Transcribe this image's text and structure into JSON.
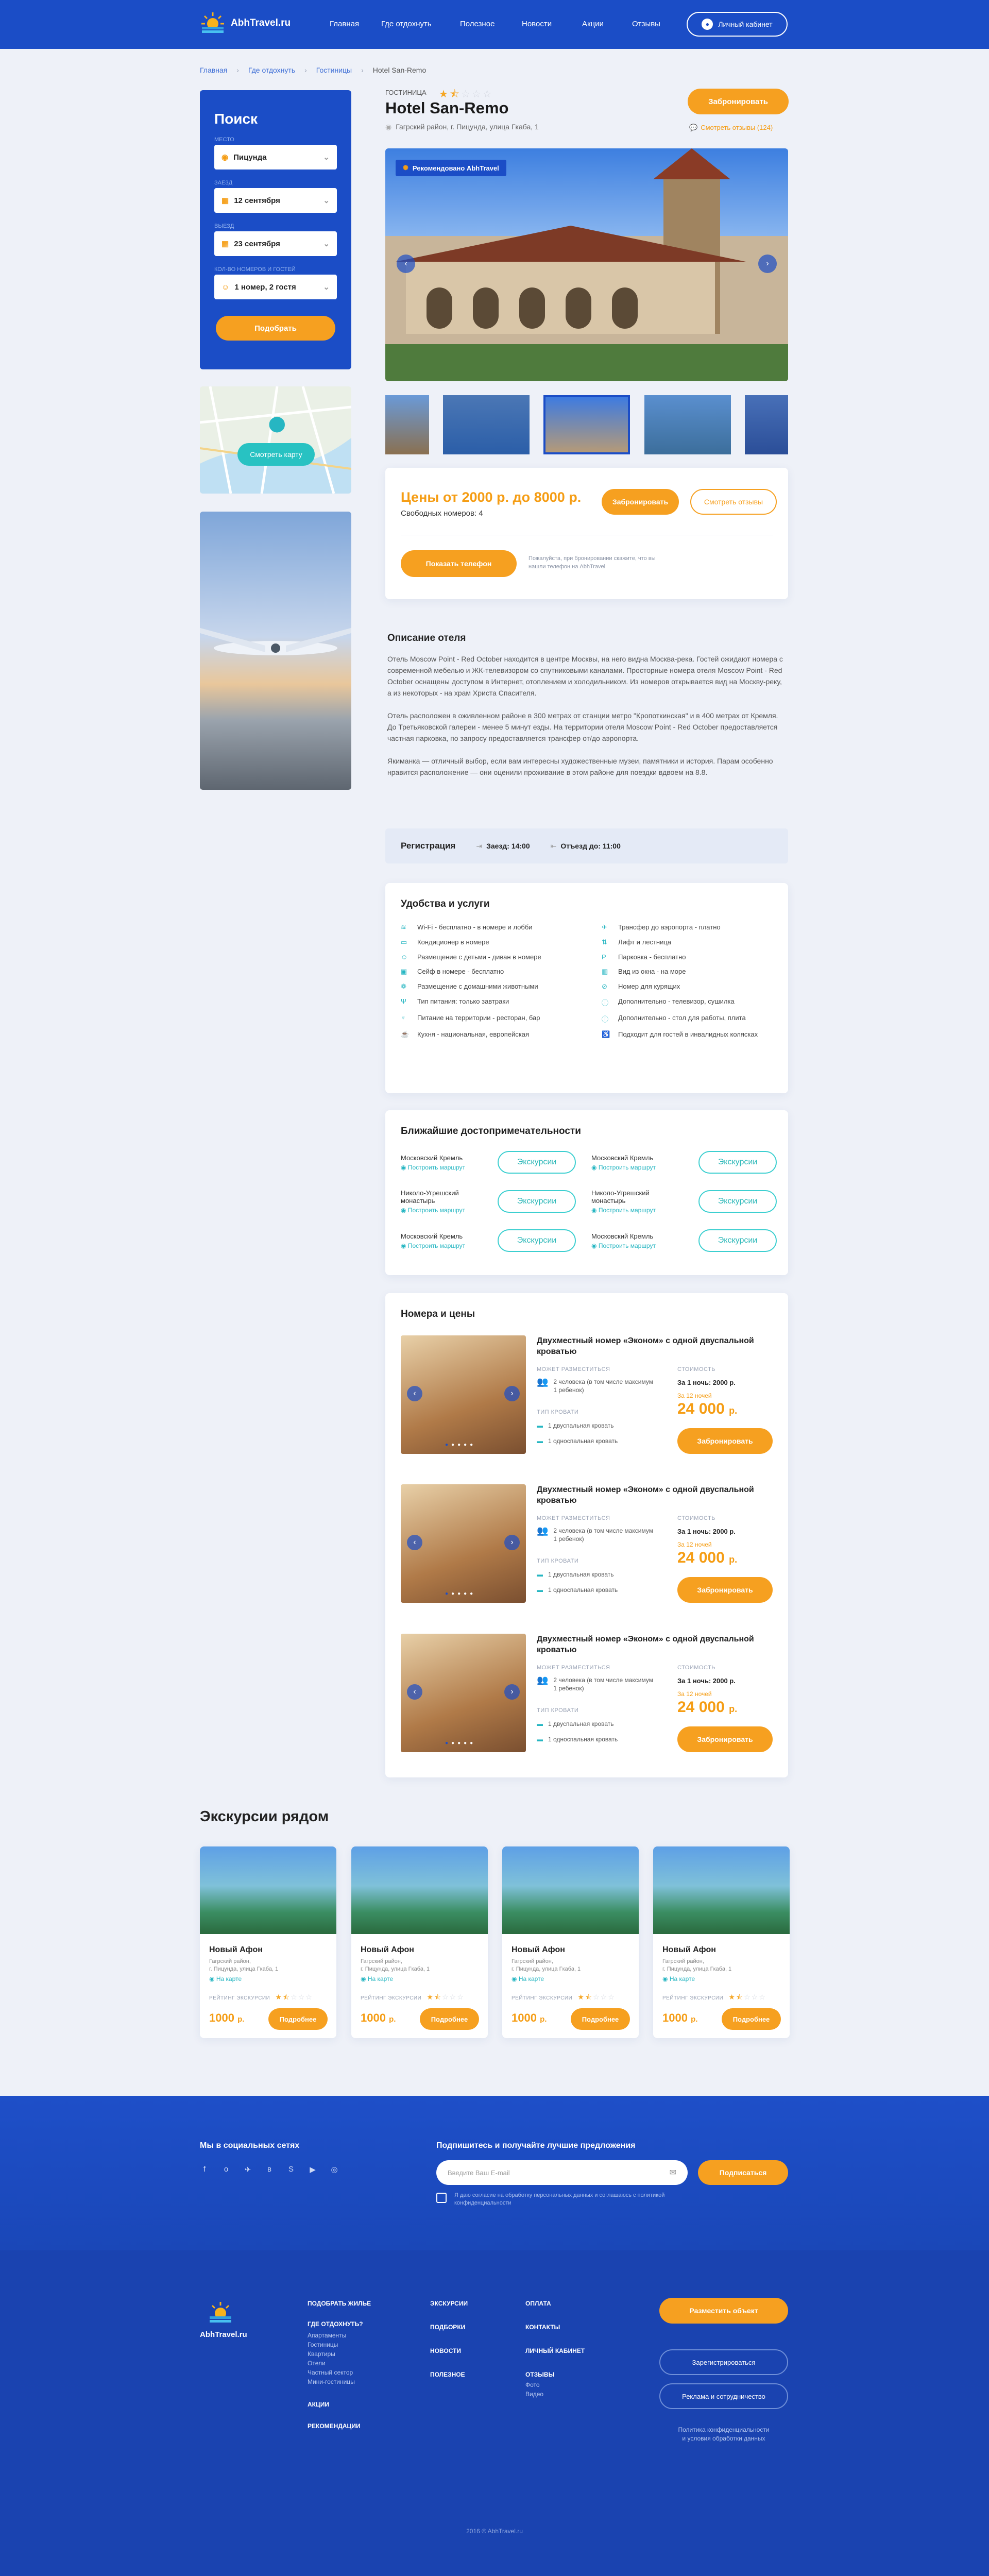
{
  "header": {
    "logo": "AbhTravel.ru",
    "nav": [
      "Главная",
      "Где отдохнуть",
      "Полезное",
      "Новости",
      "Акции",
      "Отзывы"
    ],
    "cabinet": "Личный кабинет"
  },
  "breadcrumb": [
    "Главная",
    "Где отдохнуть",
    "Гостиницы",
    "Hotel San-Remo"
  ],
  "search": {
    "title": "Поиск",
    "place_label": "МЕСТО",
    "place": "Пицунда",
    "checkin_label": "ЗАЕЗД",
    "checkin": "12 сентября",
    "checkout_label": "ВЫЕЗД",
    "checkout": "23 сентября",
    "guests_label": "КОЛ-ВО НОМЕРОВ И ГОСТЕЙ",
    "guests": "1 номер, 2 гостя",
    "button": "Подобрать"
  },
  "map_button": "Смотреть карту",
  "hotel": {
    "type": "ГОСТИНИЦА",
    "rating": 1.5,
    "name": "Hotel San-Remo",
    "address": "Гагрский район, г. Пицунда, улица Гкаба, 1",
    "book": "Забронировать",
    "reviews_link": "Смотреть отзывы (124)",
    "badge": "Рекомендовано AbhTravel"
  },
  "price": {
    "text": "Цены от 2000 р. до 8000 р.",
    "free": "Свободных номеров: 4",
    "book": "Забронировать",
    "reviews": "Смотреть отзывы",
    "phone": "Показать телефон",
    "phone_note": "Пожалуйста, при бронировании скажите, что вы нашли телефон на AbhTravel"
  },
  "description": {
    "title": "Описание отеля",
    "p1": "Отель Moscow Point - Red October находится в центре Москвы, на него видна Москва-река. Гостей ожидают номера с современной мебелью и ЖК-телевизором со спутниковыми каналами. Просторные номера отеля Moscow Point - Red October оснащены доступом в Интернет, отоплением и холодильником. Из номеров открывается вид на Москву-реку, а из некоторых - на храм Христа Спасителя.",
    "p2": "Отель расположен в оживленном районе в 300 метрах от станции метро \"Кропоткинская\" и в 400 метрах от Кремля. До Третьяковской галереи - менее 5 минут езды. На территории отеля Moscow Point - Red October предоставляется частная парковка, по запросу предоставляется трансфер от/до аэропорта.",
    "p3": "Якиманка — отличный выбор, если вам интересны художественные музеи, памятники и история. Парам особенно нравится расположение — они оценили проживание в этом районе для поездки вдвоем на 8.8."
  },
  "registration": {
    "title": "Регистрация",
    "checkin": "Заезд: 14:00",
    "checkout": "Отъезд до: 11:00"
  },
  "amenities": {
    "title": "Удобства и услуги",
    "left": [
      "Wi-Fi - бесплатно - в номере и лобби",
      "Кондиционер в номере",
      "Размещение с детьми - диван в номере",
      "Сейф в номере - бесплатно",
      "Размещение с домашними животными",
      "Тип питания: только завтраки",
      "Питание на территории - ресторан, бар",
      "Кухня - национальная, европейская"
    ],
    "right": [
      "Трансфер до аэропорта - платно",
      "Лифт и лестница",
      "Парковка - бесплатно",
      "Вид из окна - на море",
      "Номер для курящих",
      "Дополнительно - телевизор, сушилка",
      "Дополнительно - стол для работы, плита",
      "Подходит для гостей в инвалидных колясках"
    ]
  },
  "sights": {
    "title": "Ближайшие достопримечательности",
    "route": "Построить маршрут",
    "button": "Экскурсии",
    "left": [
      "Московский Кремль",
      "Николо-Угрешский монастырь",
      "Московский Кремль"
    ],
    "right": [
      "Московский Кремль",
      "Николо-Угрешский монастырь",
      "Московский Кремль"
    ]
  },
  "rooms": {
    "title": "Номера и цены",
    "name": "Двухместный номер «Эконом» с одной двуспальной кроватью",
    "place_label": "МОЖЕТ РАЗМЕСТИТЬСЯ",
    "place_value": "2 человека (в том числе максимум 1 ребенок)",
    "bed_label": "ТИП КРОВАТИ",
    "bed1": "1 двуспальная кровать",
    "bed2": "1 односпальная кровать",
    "cost_label": "СТОИМОСТЬ",
    "per_night": "За 1 ночь: 2000 р.",
    "nights": "За 12 ночей",
    "total": "24 000",
    "cur": "р.",
    "book": "Забронировать"
  },
  "excursions": {
    "title": "Экскурсии рядом",
    "name": "Новый Афон",
    "addr1": "Гагрский район,",
    "addr2": "г. Пицунда, улица Гкаба, 1",
    "map": "На карте",
    "rating_label": "РЕЙТИНГ ЭКСКУРСИИ",
    "rating": 1.5,
    "price": "1000",
    "cur": "р.",
    "more": "Подробнее"
  },
  "social": {
    "title": "Мы в социальных сетях",
    "icons": [
      "facebook-icon",
      "ok-icon",
      "telegram-icon",
      "vk-icon",
      "skype-icon",
      "youtube-icon",
      "instagram-icon"
    ],
    "glyphs": [
      "f",
      "о",
      "✈",
      "в",
      "S",
      "▶",
      "◎"
    ]
  },
  "subscribe": {
    "title": "Подпишитесь и получайте лучшие предложения",
    "placeholder": "Введите Ваш E-mail",
    "button": "Подписаться",
    "consent": "Я даю согласие на обработку персональных данных и соглашаюсь с политикой конфиденциальности"
  },
  "footer": {
    "logo": "AbhTravel.ru",
    "col1": [
      "ПОДОБРАТЬ ЖИЛЬЕ",
      "ГДЕ ОТДОХНУТЬ?"
    ],
    "col1_sub": [
      "Апартаменты",
      "Гостиницы",
      "Квартиры",
      "Отели",
      "Частный сектор",
      "Мини-гостиницы"
    ],
    "col1_tail": [
      "АКЦИИ",
      "РЕКОМЕНДАЦИИ"
    ],
    "col2": [
      "ЭКСКУРСИИ",
      "ПОДБОРКИ",
      "НОВОСТИ",
      "ПОЛЕЗНОЕ"
    ],
    "col3": [
      "ОПЛАТА",
      "КОНТАКТЫ",
      "ЛИЧНЫЙ КАБИНЕТ",
      "ОТЗЫВЫ"
    ],
    "col3_sub": [
      "Фото",
      "Видео"
    ],
    "place_btn": "Разместить объект",
    "register_btn": "Зарегистрироваться",
    "ads_btn": "Реклама и сотрудничество",
    "policy1": "Политика конфиденциальности",
    "policy2": "и условия обработки данных",
    "copy": "2016 © AbhTravel.ru"
  }
}
